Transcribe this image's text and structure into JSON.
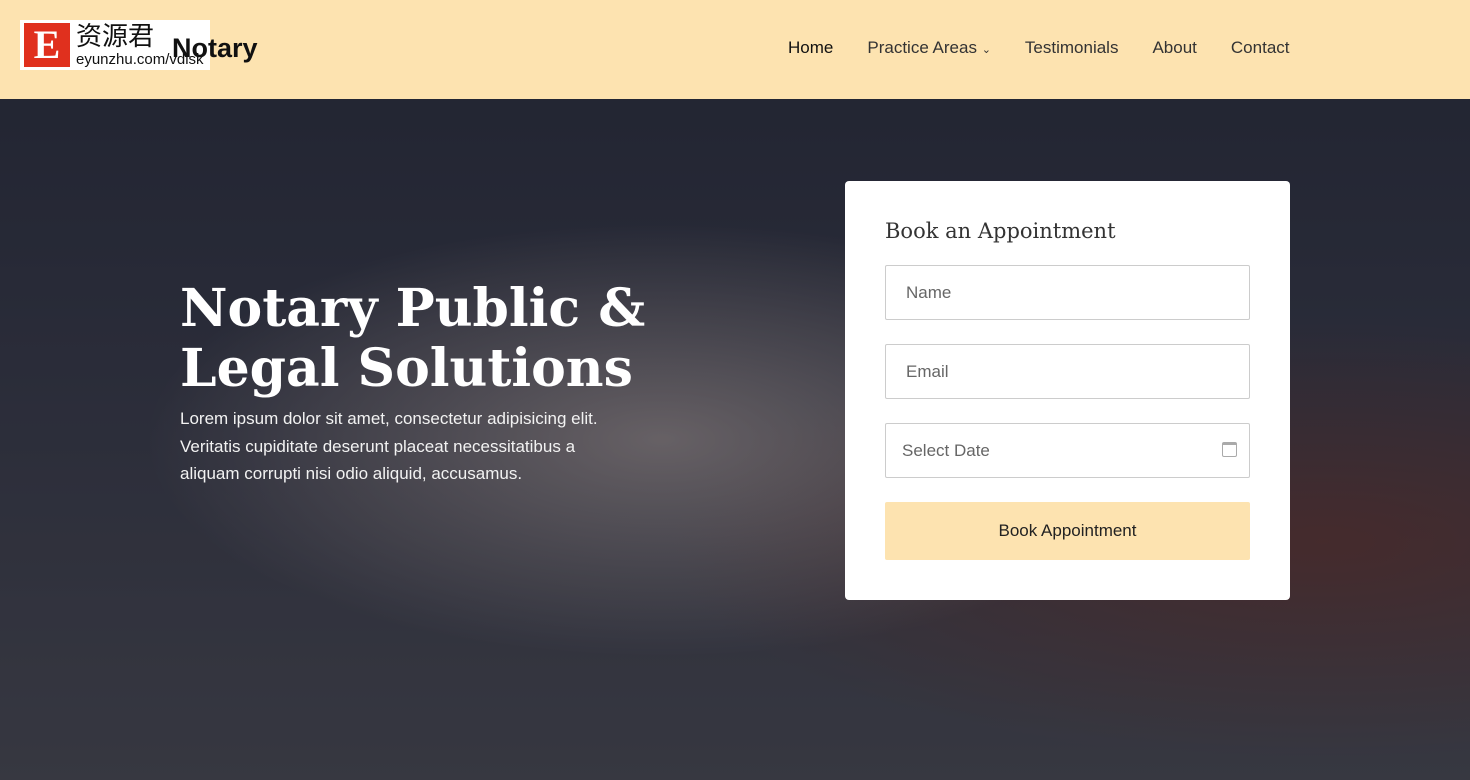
{
  "header": {
    "brand": "Notary",
    "watermark": {
      "letter": "E",
      "chinese": "资源君",
      "url": "eyunzhu.com/vdisk"
    },
    "nav": [
      {
        "label": "Home"
      },
      {
        "label": "Practice Areas"
      },
      {
        "label": "Testimonials"
      },
      {
        "label": "About"
      },
      {
        "label": "Contact"
      }
    ]
  },
  "hero": {
    "title_bold": "Notary Public",
    "title_amp": " &",
    "title_line2": "Legal Solutions",
    "description": "Lorem ipsum dolor sit amet, consectetur adipisicing elit. Veritatis cupiditate deserunt placeat necessitatibus a aliquam corrupti nisi odio aliquid, accusamus."
  },
  "form": {
    "title": "Book an Appointment",
    "name_placeholder": "Name",
    "email_placeholder": "Email",
    "date_placeholder": "Select Date",
    "submit_label": "Book Appointment"
  },
  "colors": {
    "header_bg": "#fde3b0",
    "button_bg": "#fde3b0"
  }
}
